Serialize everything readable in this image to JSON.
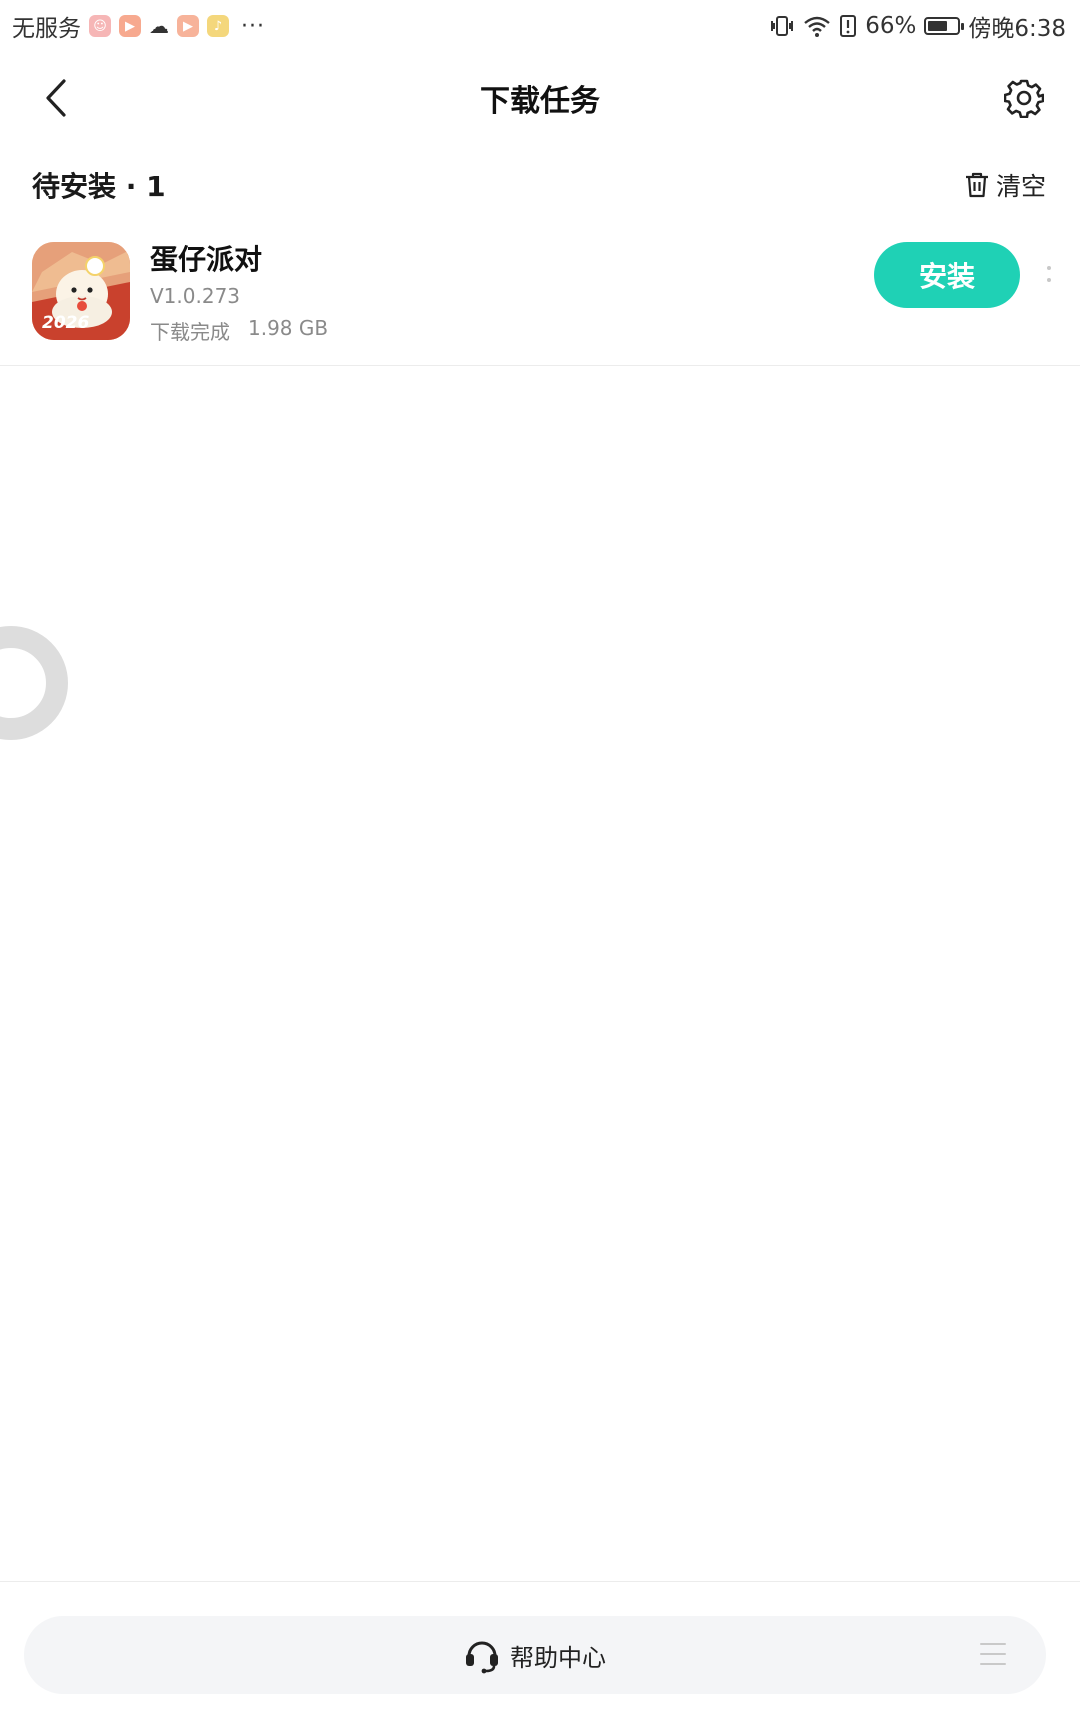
{
  "status_bar": {
    "carrier": "无服务",
    "more": "···",
    "battery_percent": "66%",
    "battery_level": 0.66,
    "time": "傍晚6:38"
  },
  "header": {
    "title": "下载任务",
    "back_icon": "chevron-left-icon",
    "settings_icon": "gear-icon"
  },
  "section": {
    "title": "待安装 · 1",
    "clear_label": "清空"
  },
  "tasks": [
    {
      "name": "蛋仔派对",
      "version": "V1.0.273",
      "status": "下载完成",
      "size": "1.98 GB",
      "icon_text": "2026",
      "action_label": "安装"
    }
  ],
  "footer": {
    "help_label": "帮助中心"
  },
  "colors": {
    "accent": "#1fd1b5",
    "text_primary": "#111111",
    "text_secondary": "#8a8a8a",
    "bar_background": "#f4f5f7"
  }
}
